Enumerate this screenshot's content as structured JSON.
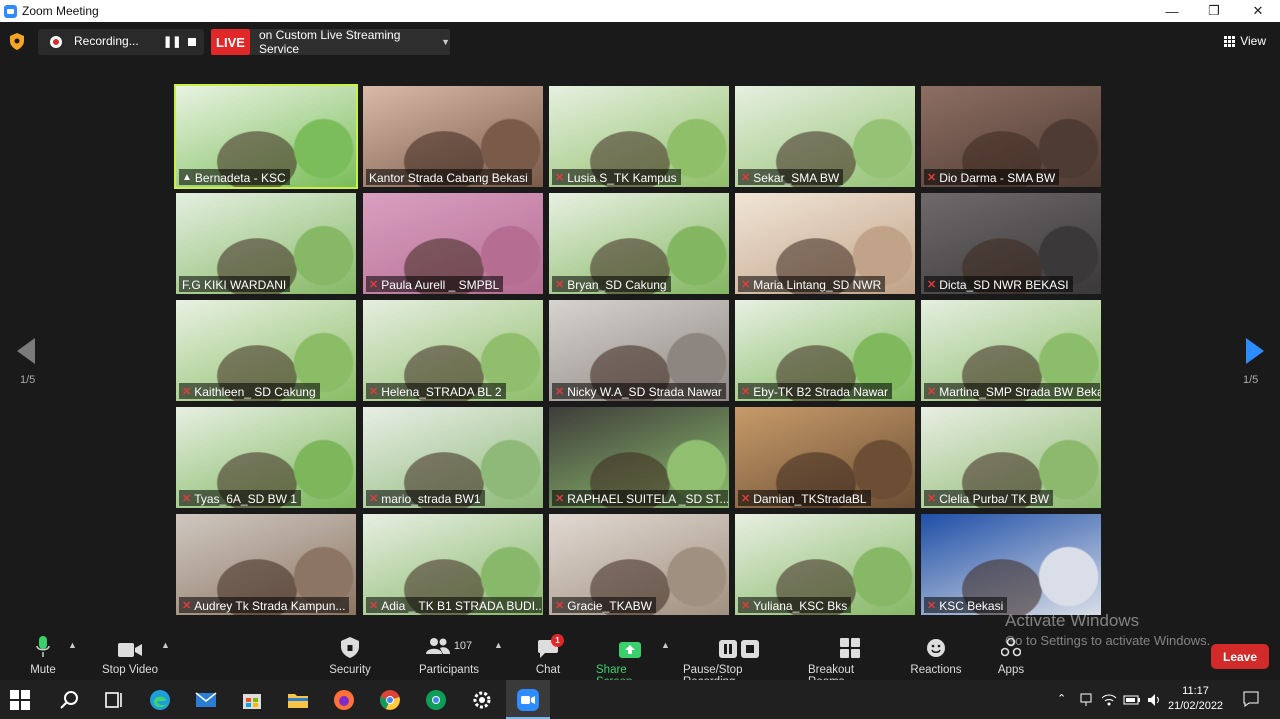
{
  "window": {
    "title": "Zoom Meeting"
  },
  "topbar": {
    "recording_text": "Recording...",
    "live_label": "LIVE",
    "live_service": "on Custom Live Streaming Service",
    "view_label": "View"
  },
  "pagination": {
    "left": "1/5",
    "right": "1/5"
  },
  "participants": [
    {
      "name": "Bernadeta - KSC",
      "muted": false,
      "pinned": true
    },
    {
      "name": "Kantor Strada Cabang Bekasi",
      "muted": false
    },
    {
      "name": "Lusia S_TK Kampus",
      "muted": true
    },
    {
      "name": "Sekar_SMA BW",
      "muted": true
    },
    {
      "name": "Dio Darma - SMA BW",
      "muted": true
    },
    {
      "name": "F.G KIKI WARDANI",
      "muted": false
    },
    {
      "name": "Paula Aurell _ SMPBL",
      "muted": true
    },
    {
      "name": "Bryan_SD Cakung",
      "muted": true
    },
    {
      "name": "Maria Lintang_SD NWR",
      "muted": true
    },
    {
      "name": "Dicta_SD NWR BEKASI",
      "muted": true
    },
    {
      "name": "Kaithleen_ SD Cakung",
      "muted": true
    },
    {
      "name": "Helena_STRADA BL 2",
      "muted": true
    },
    {
      "name": "Nicky W.A_SD Strada Nawar",
      "muted": true
    },
    {
      "name": "Eby-TK B2 Strada Nawar",
      "muted": true
    },
    {
      "name": "Martina_SMP Strada BW Bekasi",
      "muted": true
    },
    {
      "name": "Tyas_6A_SD BW 1",
      "muted": true
    },
    {
      "name": "mario_strada BW1",
      "muted": true
    },
    {
      "name": "RAPHAEL SUITELA _SD ST...",
      "muted": true
    },
    {
      "name": "Damian_TKStradaBL",
      "muted": true
    },
    {
      "name": "Clelia Purba/ TK BW",
      "muted": true
    },
    {
      "name": "Audrey Tk Strada Kampun...",
      "muted": true
    },
    {
      "name": "Adia _ TK B1 STRADA BUDI...",
      "muted": true
    },
    {
      "name": "Gracie_TKABW",
      "muted": true
    },
    {
      "name": "Yuliana_KSC Bks",
      "muted": true
    },
    {
      "name": "KSC Bekasi",
      "muted": true
    }
  ],
  "toolbar": {
    "mute": "Mute",
    "stop_video": "Stop Video",
    "security": "Security",
    "participants": "Participants",
    "participant_count": "107",
    "chat": "Chat",
    "chat_badge": "1",
    "share_screen": "Share Screen",
    "pause_stop_recording": "Pause/Stop Recording",
    "breakout_rooms": "Breakout Rooms",
    "reactions": "Reactions",
    "apps": "Apps",
    "leave": "Leave"
  },
  "watermark": {
    "line1": "Activate Windows",
    "line2": "Go to Settings to activate Windows."
  },
  "taskbar": {
    "time": "11:17",
    "date": "21/02/2022"
  },
  "colors": {
    "accent_green": "#3ad16c",
    "live_red": "#e02828",
    "active_speaker": "#c9f043",
    "leave_red": "#d32a2a"
  }
}
